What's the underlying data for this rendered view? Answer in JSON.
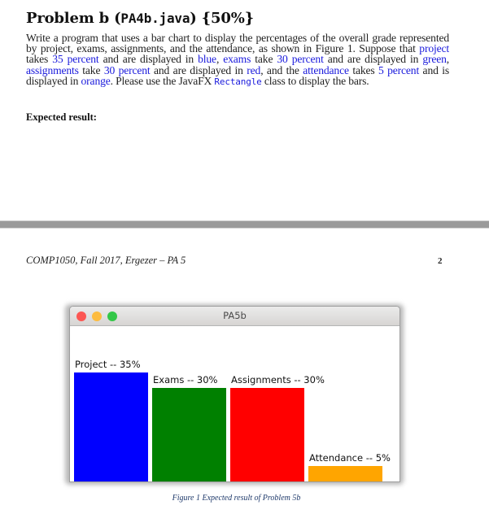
{
  "document": {
    "heading": {
      "prefix": "Problem b (",
      "filename": "PA4b.java",
      "suffix": ") {50%}"
    },
    "paragraph": {
      "lines": [
        [
          {
            "t": "Write a program that uses a bar chart to display the percentages of the overall grade represented"
          }
        ],
        [
          {
            "t": "by project, exams, assignments, and the attendance, as shown in Figure 1. Suppose that "
          },
          {
            "t": "project",
            "c": "blue"
          }
        ],
        [
          {
            "t": "takes "
          },
          {
            "t": "35 percent",
            "c": "blue"
          },
          {
            "t": " and are displayed in "
          },
          {
            "t": "blue",
            "c": "blue"
          },
          {
            "t": ", "
          },
          {
            "t": "exams",
            "c": "blue"
          },
          {
            "t": " take "
          },
          {
            "t": "30 percent",
            "c": "blue"
          },
          {
            "t": " and are displayed in "
          },
          {
            "t": "green",
            "c": "blue"
          },
          {
            "t": ","
          }
        ],
        [
          {
            "t": "assignments",
            "c": "blue"
          },
          {
            "t": " take "
          },
          {
            "t": "30 percent",
            "c": "blue"
          },
          {
            "t": " and are displayed in "
          },
          {
            "t": "red",
            "c": "blue"
          },
          {
            "t": ", and the "
          },
          {
            "t": "attendance",
            "c": "blue"
          },
          {
            "t": " takes "
          },
          {
            "t": "5 percent",
            "c": "blue"
          },
          {
            "t": " and is"
          }
        ],
        [
          {
            "t": "displayed in "
          },
          {
            "t": "orange",
            "c": "blue"
          },
          {
            "t": ". Please use the JavaFX "
          },
          {
            "t": "Rectangle",
            "c": "code"
          },
          {
            "t": " class to display the bars."
          }
        ]
      ]
    },
    "expected_label": "Expected result:",
    "footer": {
      "text": "COMP1050, Fall 2017, Ergezer – PA 5",
      "page_number": "2"
    },
    "caption": "Figure 1 Expected result of Problem 5b"
  },
  "app_window": {
    "title": "PA5b",
    "controls": [
      "close",
      "minimize",
      "maximize"
    ],
    "colors": {
      "close": "#fc5753",
      "minimize": "#fdbc40",
      "maximize": "#33c748"
    }
  },
  "chart_data": {
    "type": "bar",
    "title": "PA5b",
    "xlabel": "",
    "ylabel": "",
    "categories": [
      "Project",
      "Exams",
      "Assignments",
      "Attendance"
    ],
    "values": [
      35,
      30,
      30,
      5
    ],
    "labels": [
      "Project -- 35%",
      "Exams -- 30%",
      "Assignments -- 30%",
      "Attendance -- 5%"
    ],
    "colors": [
      "#0000ff",
      "#008000",
      "#ff0000",
      "#ffa500"
    ],
    "ylim": [
      0,
      40
    ],
    "grid": false,
    "legend": "none"
  }
}
